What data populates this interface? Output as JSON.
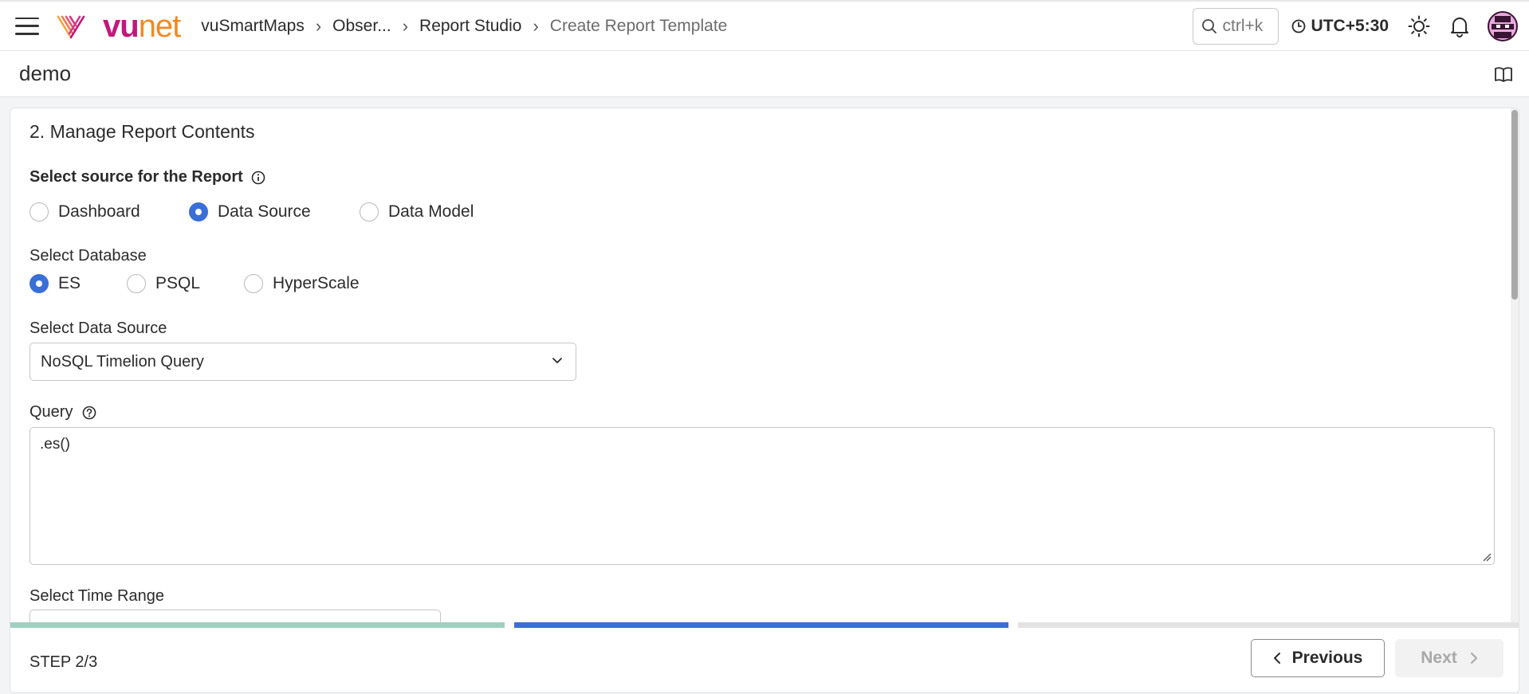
{
  "header": {
    "logo": {
      "vu": "vu",
      "net": "net"
    },
    "breadcrumb": [
      "vuSmartMaps",
      "Obser...",
      "Report Studio",
      "Create Report Template"
    ],
    "search_placeholder": "ctrl+k",
    "timezone": "UTC+5:30"
  },
  "page": {
    "title": "demo"
  },
  "form": {
    "section_title": "2. Manage Report Contents",
    "source_label": "Select source for the Report",
    "source_options": [
      {
        "label": "Dashboard",
        "checked": false
      },
      {
        "label": "Data Source",
        "checked": true
      },
      {
        "label": "Data Model",
        "checked": false
      }
    ],
    "database_label": "Select Database",
    "database_options": [
      {
        "label": "ES",
        "checked": true
      },
      {
        "label": "PSQL",
        "checked": false
      },
      {
        "label": "HyperScale",
        "checked": false
      }
    ],
    "data_source_label": "Select Data Source",
    "data_source_value": "NoSQL Timelion Query",
    "query_label": "Query",
    "query_value": ".es()",
    "time_range_label": "Select Time Range"
  },
  "wizard": {
    "step_label": "STEP 2/3",
    "current_step": 2,
    "total_steps": 3,
    "colors": {
      "done": "#9fd0bf",
      "active": "#3a6fd8",
      "pending": "#e3e3e3"
    },
    "previous_label": "Previous",
    "next_label": "Next"
  }
}
